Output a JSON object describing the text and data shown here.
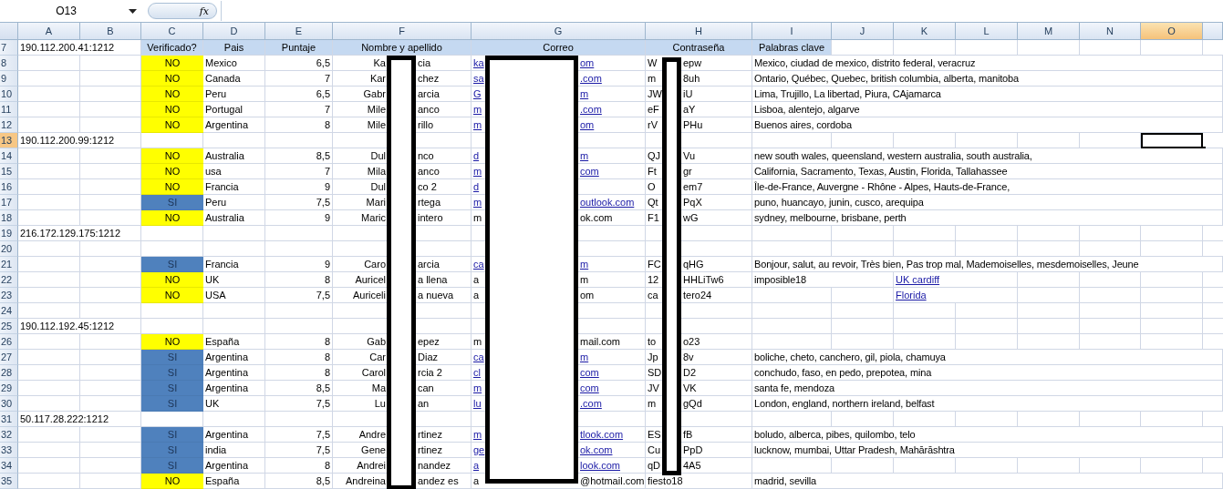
{
  "formula_bar": {
    "name_box": "O13",
    "function_label": "fx"
  },
  "columns": [
    {
      "label": "A",
      "selected": false
    },
    {
      "label": "B",
      "selected": false
    },
    {
      "label": "C",
      "selected": false
    },
    {
      "label": "D",
      "selected": false
    },
    {
      "label": "E",
      "selected": false
    },
    {
      "label": "F",
      "selected": false
    },
    {
      "label": "G",
      "selected": false
    },
    {
      "label": "H",
      "selected": false
    },
    {
      "label": "I",
      "selected": false
    },
    {
      "label": "J",
      "selected": false
    },
    {
      "label": "K",
      "selected": false
    },
    {
      "label": "L",
      "selected": false
    },
    {
      "label": "M",
      "selected": false
    },
    {
      "label": "N",
      "selected": false
    },
    {
      "label": "O",
      "selected": true
    }
  ],
  "rows": [
    {
      "number": "7",
      "selected": false,
      "kind": "header",
      "address": "190.112.200.41:1212",
      "labels": [
        "Verificado?",
        "Pais",
        "Puntaje",
        "Nombre y apellido",
        "Correo",
        "Contraseña",
        "Palabras clave"
      ]
    },
    {
      "number": "8",
      "selected": false,
      "kind": "entry",
      "verified": false,
      "verificado": "NO",
      "pais": "Mexico",
      "puntaje": "6,5",
      "name": [
        "Ka",
        "cia"
      ],
      "email": {
        "start": "ka",
        "end": "om",
        "link": true
      },
      "password": {
        "start": "W",
        "end": "epw"
      },
      "keywords": "Mexico, ciudad de mexico, distrito federal, veracruz"
    },
    {
      "number": "9",
      "selected": false,
      "kind": "entry",
      "verified": false,
      "verificado": "NO",
      "pais": "Canada",
      "puntaje": "7",
      "name": [
        "Kar",
        "chez"
      ],
      "email": {
        "start": "sa",
        "end": ".com",
        "link": true
      },
      "password": {
        "start": "m",
        "end": "8uh"
      },
      "keywords": "Ontario, Québec, Quebec, british columbia, alberta, manitoba"
    },
    {
      "number": "10",
      "selected": false,
      "kind": "entry",
      "verified": false,
      "verificado": "NO",
      "pais": "Peru",
      "puntaje": "6,5",
      "name": [
        "Gabr",
        "arcia"
      ],
      "email": {
        "start": "G",
        "end": "m",
        "link": true
      },
      "password": {
        "start": "JW",
        "end": "iU"
      },
      "keywords": "Lima, Trujillo, La libertad, Piura, CAjamarca"
    },
    {
      "number": "11",
      "selected": false,
      "kind": "entry",
      "verified": false,
      "verificado": "NO",
      "pais": "Portugal",
      "puntaje": "7",
      "name": [
        "Mile",
        "anco"
      ],
      "email": {
        "start": "m",
        "end": ".com",
        "link": true
      },
      "password": {
        "start": "eF",
        "end": "aY"
      },
      "keywords": "Lisboa, alentejo, algarve"
    },
    {
      "number": "12",
      "selected": false,
      "kind": "entry",
      "verified": false,
      "verificado": "NO",
      "pais": "Argentina",
      "puntaje": "8",
      "name": [
        "Mile",
        "rillo"
      ],
      "email": {
        "start": "m",
        "end": "om",
        "link": true
      },
      "password": {
        "start": "rV",
        "end": "PHu"
      },
      "keywords": "Buenos aires, cordoba"
    },
    {
      "number": "13",
      "selected": true,
      "kind": "group",
      "address": "190.112.200.99:1212"
    },
    {
      "number": "14",
      "selected": false,
      "kind": "entry",
      "verified": false,
      "verificado": "NO",
      "pais": "Australia",
      "puntaje": "8,5",
      "name": [
        "Dul",
        "nco"
      ],
      "email": {
        "start": "d",
        "end": "m",
        "link": true
      },
      "password": {
        "start": "QJ",
        "end": "Vu"
      },
      "keywords": "new south wales, queensland, western australia, south australia,"
    },
    {
      "number": "15",
      "selected": false,
      "kind": "entry",
      "verified": false,
      "verificado": "NO",
      "pais": "usa",
      "puntaje": "7",
      "name": [
        "Mila",
        "anco"
      ],
      "email": {
        "start": "m",
        "end": "com",
        "link": true
      },
      "password": {
        "start": "Ft",
        "end": "gr"
      },
      "keywords": "California, Sacramento, Texas, Austin, Florida, Tallahassee"
    },
    {
      "number": "16",
      "selected": false,
      "kind": "entry",
      "verified": false,
      "verificado": "NO",
      "pais": "Francia",
      "puntaje": "9",
      "name": [
        "Dul",
        "co 2"
      ],
      "email": {
        "start": "d",
        "link": true
      },
      "password": {
        "start": "O",
        "end": "em7"
      },
      "keywords": "Île-de-France, Auvergne - Rhône - Alpes, Hauts-de-France,"
    },
    {
      "number": "17",
      "selected": false,
      "kind": "entry",
      "verified": true,
      "verificado": "SI",
      "pais": "Peru",
      "puntaje": "7,5",
      "name": [
        "Mari",
        "rtega"
      ],
      "email": {
        "start": "m",
        "end": "outlook.com",
        "link": true
      },
      "password": {
        "start": "Qt",
        "end": "PqX"
      },
      "keywords": "puno, huancayo, junin, cusco, arequipa"
    },
    {
      "number": "18",
      "selected": false,
      "kind": "entry",
      "verified": false,
      "verificado": "NO",
      "pais": "Australia",
      "puntaje": "9",
      "name": [
        "Maric",
        "intero"
      ],
      "email": {
        "start": "m",
        "end": "ok.com",
        "link": false
      },
      "password": {
        "start": "F1",
        "end": "wG"
      },
      "keywords": "sydney, melbourne, brisbane, perth"
    },
    {
      "number": "19",
      "selected": false,
      "kind": "group",
      "address": "216.172.129.175:1212"
    },
    {
      "number": "20",
      "selected": false,
      "kind": "blank"
    },
    {
      "number": "21",
      "selected": false,
      "kind": "entry",
      "verified": true,
      "verificado": "SI",
      "pais": "Francia",
      "puntaje": "9",
      "name": [
        "Caro",
        "arcia"
      ],
      "email": {
        "start": "ca",
        "end": "m",
        "link": true
      },
      "password": {
        "start": "FC",
        "end": "qHG"
      },
      "keywords": "Bonjour, salut, au revoir, Très bien, Pas trop mal, Mademoiselles, mesdemoiselles, Jeune"
    },
    {
      "number": "22",
      "selected": false,
      "kind": "entry",
      "verified": false,
      "verificado": "NO",
      "pais": "UK",
      "puntaje": "8",
      "name": [
        "Auricel",
        "a llena"
      ],
      "email": {
        "start": "a",
        "end": "m",
        "link": false
      },
      "password": {
        "start": "12",
        "end": "HHLiTw6"
      },
      "keywords": "imposible18",
      "extra_link": "UK cardiff"
    },
    {
      "number": "23",
      "selected": false,
      "kind": "entry",
      "verified": false,
      "verificado": "NO",
      "pais": "USA",
      "puntaje": "7,5",
      "name": [
        "Auriceli",
        "a nueva"
      ],
      "email": {
        "start": "a",
        "end": "om",
        "link": false
      },
      "password": {
        "start": "ca",
        "end": "tero24"
      },
      "extra_link": "Florida"
    },
    {
      "number": "24",
      "selected": false,
      "kind": "blank"
    },
    {
      "number": "25",
      "selected": false,
      "kind": "group",
      "address": "190.112.192.45:1212"
    },
    {
      "number": "26",
      "selected": false,
      "kind": "entry",
      "verified": false,
      "verificado": "NO",
      "pais": "España",
      "puntaje": "8",
      "name": [
        "Gab",
        "epez"
      ],
      "email": {
        "start": "m",
        "end": "mail.com",
        "link": false
      },
      "password": {
        "start": "to",
        "end": "o23"
      }
    },
    {
      "number": "27",
      "selected": false,
      "kind": "entry",
      "verified": true,
      "verificado": "SI",
      "pais": "Argentina",
      "puntaje": "8",
      "name": [
        "Car",
        "Diaz"
      ],
      "email": {
        "start": "ca",
        "end": "m",
        "link": true
      },
      "password": {
        "start": "Jp",
        "end": "8v"
      },
      "keywords": "boliche, cheto, canchero, gil, piola, chamuya"
    },
    {
      "number": "28",
      "selected": false,
      "kind": "entry",
      "verified": true,
      "verificado": "SI",
      "pais": "Argentina",
      "puntaje": "8",
      "name": [
        "Carol",
        "rcia 2"
      ],
      "email": {
        "start": "cl",
        "end": "com",
        "link": true
      },
      "password": {
        "start": "SD",
        "end": "D2"
      },
      "keywords": "conchudo, faso, en pedo, prepotea, mina"
    },
    {
      "number": "29",
      "selected": false,
      "kind": "entry",
      "verified": true,
      "verificado": "SI",
      "pais": "Argentina",
      "puntaje": "8,5",
      "name": [
        "Ma",
        "can"
      ],
      "email": {
        "start": "m",
        "end": "com",
        "link": true
      },
      "password": {
        "start": "JV",
        "end": "VK"
      },
      "keywords": "santa fe, mendoza"
    },
    {
      "number": "30",
      "selected": false,
      "kind": "entry",
      "verified": true,
      "verificado": "SI",
      "pais": "UK",
      "puntaje": "7,5",
      "name": [
        "Lu",
        "an"
      ],
      "email": {
        "start": "lu",
        "end": ".com",
        "link": true
      },
      "password": {
        "start": "m",
        "end": "gQd"
      },
      "keywords": "London, england, northern ireland, belfast"
    },
    {
      "number": "31",
      "selected": false,
      "kind": "group",
      "address": "50.117.28.222:1212"
    },
    {
      "number": "32",
      "selected": false,
      "kind": "entry",
      "verified": true,
      "verificado": "SI",
      "pais": "Argentina",
      "puntaje": "7,5",
      "name": [
        "Andre",
        "rtinez"
      ],
      "email": {
        "start": "m",
        "end": "tlook.com",
        "link": true
      },
      "password": {
        "start": "ES",
        "end": "fB"
      },
      "keywords": "boludo, alberca, pibes, quilombo, telo"
    },
    {
      "number": "33",
      "selected": false,
      "kind": "entry",
      "verified": true,
      "verificado": "SI",
      "pais": "india",
      "puntaje": "7,5",
      "name": [
        "Gene",
        "rtinez"
      ],
      "email": {
        "start": "ge",
        "end": "ok.com",
        "link": true
      },
      "password": {
        "start": "Cu",
        "end": "PpD"
      },
      "keywords": "lucknow, mumbai, Uttar Pradesh, Mahārāshtra"
    },
    {
      "number": "34",
      "selected": false,
      "kind": "entry",
      "verified": true,
      "verificado": "SI",
      "pais": "Argentina",
      "puntaje": "8",
      "name": [
        "Andrei",
        "nandez"
      ],
      "email": {
        "start": "a",
        "end": "look.com",
        "link": true
      },
      "password": {
        "start": "qD",
        "end": "4A5"
      }
    },
    {
      "number": "35",
      "selected": false,
      "kind": "entry",
      "verified": false,
      "verificado": "NO",
      "pais": "España",
      "puntaje": "8,5",
      "name": [
        "Andreina",
        "andez es"
      ],
      "email": {
        "start": "a",
        "end": "@hotmail.com",
        "link": false
      },
      "password": {
        "text": "fiesto18"
      },
      "keywords": "madrid, sevilla"
    }
  ]
}
